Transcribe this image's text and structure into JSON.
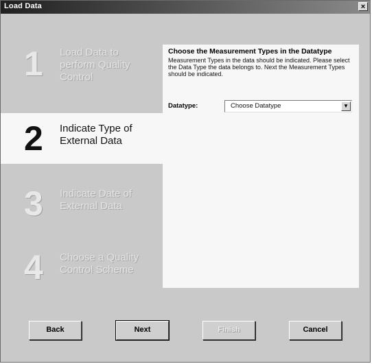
{
  "window": {
    "title": "Load Data",
    "close_glyph": "×"
  },
  "steps": [
    {
      "number": "1",
      "label": "Load Data to perform Quality Control",
      "state": "inactive"
    },
    {
      "number": "2",
      "label": "Indicate Type of External Data",
      "state": "active"
    },
    {
      "number": "3",
      "label": "Indicate Date of External Data",
      "state": "inactive"
    },
    {
      "number": "4",
      "label": "Choose a Quality Control Scheme",
      "state": "inactive"
    }
  ],
  "panel": {
    "heading": "Choose the Measurement Types in the Datatype",
    "description": "Measurement Types in the data should be indicated. Please select the Data Type the data belongs to. Next the Measurement Types should be indicated.",
    "datatype_label": "Datatype:",
    "datatype_value": "Choose Datatype",
    "dropdown_icon": "chevron-down-icon"
  },
  "buttons": {
    "back": "Back",
    "next": "Next",
    "finish": "Finish",
    "cancel": "Cancel"
  },
  "colors": {
    "window_bg": "#c9c9c9",
    "panel_bg": "#f7f7f7"
  }
}
